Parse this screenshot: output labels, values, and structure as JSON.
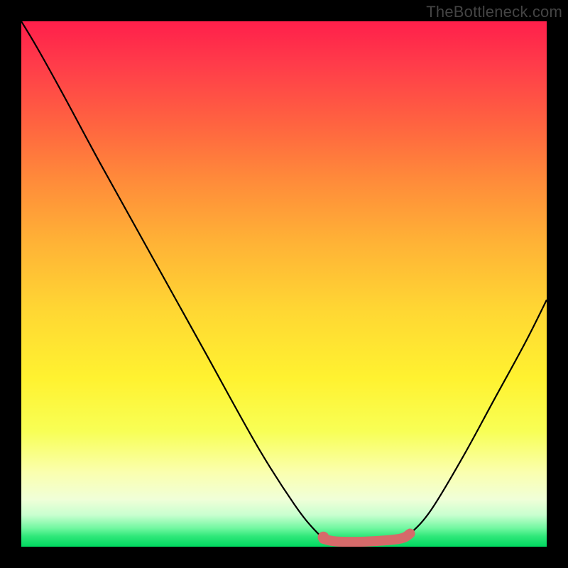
{
  "watermark": "TheBottleneck.com",
  "chart_data": {
    "type": "line",
    "title": "",
    "xlabel": "",
    "ylabel": "",
    "xlim": [
      0,
      1
    ],
    "ylim": [
      0,
      1
    ],
    "series": [
      {
        "name": "bottleneck-curve",
        "x": [
          0.0,
          0.03,
          0.08,
          0.15,
          0.25,
          0.35,
          0.45,
          0.52,
          0.56,
          0.58,
          0.6,
          0.66,
          0.72,
          0.74,
          0.78,
          0.84,
          0.9,
          0.96,
          1.0
        ],
        "y": [
          1.0,
          0.95,
          0.86,
          0.73,
          0.55,
          0.37,
          0.19,
          0.08,
          0.03,
          0.015,
          0.01,
          0.01,
          0.015,
          0.025,
          0.07,
          0.17,
          0.28,
          0.39,
          0.47
        ]
      }
    ],
    "highlight": {
      "name": "optimal-range",
      "x": [
        0.575,
        0.6,
        0.66,
        0.72,
        0.74
      ],
      "y": [
        0.015,
        0.01,
        0.01,
        0.015,
        0.025
      ],
      "dot_x": 0.575,
      "dot_y": 0.018
    },
    "background_gradient": {
      "top": "#ff1f4b",
      "mid": "#fff230",
      "bottom": "#00d860"
    }
  }
}
